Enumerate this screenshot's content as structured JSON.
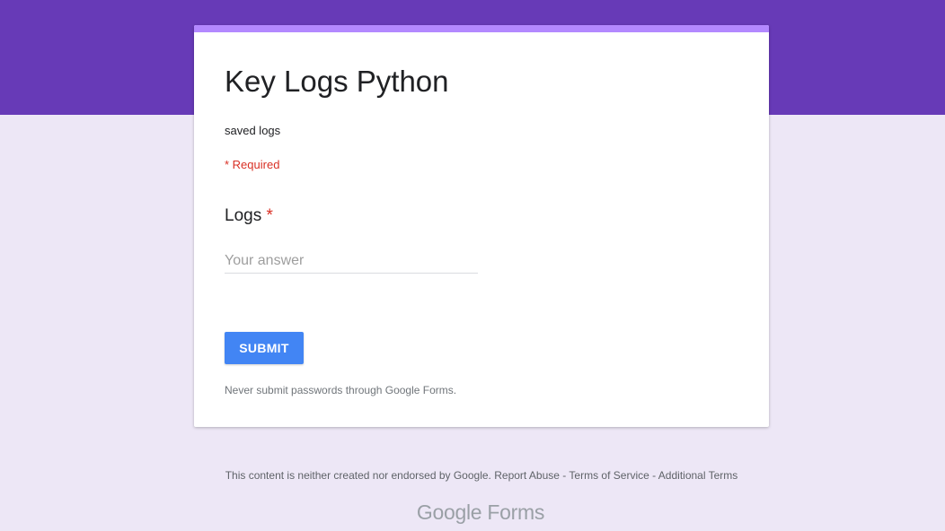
{
  "colors": {
    "theme": "#673ab7",
    "accent": "#b388ff",
    "background": "#ede7f6",
    "button": "#4285f4",
    "required": "#d93025"
  },
  "form": {
    "title": "Key Logs Python",
    "description": "saved logs",
    "required_note": "* Required",
    "questions": [
      {
        "label": "Logs",
        "required_marker": "*",
        "placeholder": "Your answer",
        "value": ""
      }
    ],
    "submit_label": "SUBMIT",
    "password_warning": "Never submit passwords through Google Forms."
  },
  "footer": {
    "disclaimer": "This content is neither created nor endorsed by Google.",
    "links": [
      "Report Abuse",
      "Terms of Service",
      "Additional Terms"
    ],
    "separator": "-",
    "logo_google": "Google",
    "logo_forms": "Forms"
  }
}
